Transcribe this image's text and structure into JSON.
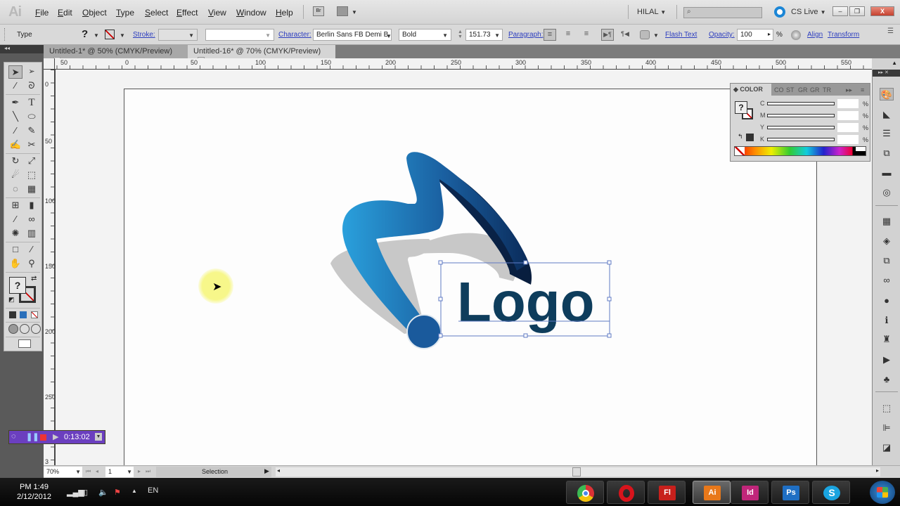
{
  "app": {
    "logo": "Ai",
    "name": "Adobe Illustrator"
  },
  "menu": [
    "File",
    "Edit",
    "Object",
    "Type",
    "Select",
    "Effect",
    "View",
    "Window",
    "Help"
  ],
  "menubar_right": {
    "workspace": "HILAL",
    "search_placeholder": "",
    "cs_live": "CS Live"
  },
  "window_controls": {
    "minimize": "–",
    "restore": "❐",
    "close": "X"
  },
  "control_bar": {
    "tool_name": "Type",
    "fill": "?",
    "stroke_label": "Stroke:",
    "stroke_value": "",
    "style_value": "",
    "character_label": "Character:",
    "font_family": "Berlin Sans FB Demi B",
    "font_style": "Bold",
    "font_size": "151.73",
    "paragraph_label": "Paragraph:",
    "flash_text": "Flash Text",
    "opacity_label": "Opacity:",
    "opacity_value": "100",
    "opacity_unit": "%",
    "align": "Align",
    "transform": "Transform"
  },
  "tabs": [
    {
      "label": "Untitled-1* @ 50% (CMYK/Preview)",
      "active": false
    },
    {
      "label": "Untitled-16* @ 70% (CMYK/Preview)",
      "active": true
    }
  ],
  "tools": [
    "selection",
    "direct-selection",
    "magic-wand",
    "lasso",
    "pen",
    "type",
    "line",
    "ellipse",
    "paintbrush",
    "pencil",
    "blob-brush",
    "scissors",
    "rotate",
    "scale",
    "warp",
    "free-transform",
    "shape-builder",
    "perspective-grid",
    "mesh",
    "gradient",
    "eyedropper",
    "blend",
    "symbol-sprayer",
    "column-graph",
    "artboard",
    "slice",
    "hand",
    "zoom"
  ],
  "ruler": {
    "horizontal": [
      "50",
      "0",
      "50",
      "100",
      "150",
      "200",
      "250",
      "300",
      "350",
      "400",
      "450",
      "500",
      "550"
    ],
    "vertical": [
      "0",
      "50",
      "100",
      "150",
      "200",
      "250",
      "3"
    ]
  },
  "artwork": {
    "logo_text": "Logo",
    "colors": {
      "gradient_light": "#2a9ad8",
      "gradient_dark": "#0b2c5c",
      "text": "#0e3d5c",
      "shadow": "#c8c8c8"
    }
  },
  "color_panel": {
    "title": "COLOR",
    "other_tabs": [
      "CO",
      "ST",
      "GR",
      "GR",
      "TR"
    ],
    "sliders": [
      {
        "label": "C",
        "value": "",
        "unit": "%"
      },
      {
        "label": "M",
        "value": "",
        "unit": "%"
      },
      {
        "label": "Y",
        "value": "",
        "unit": "%"
      },
      {
        "label": "K",
        "value": "",
        "unit": "%"
      }
    ]
  },
  "dock_icons": [
    "color",
    "color-guide",
    "stroke",
    "transparency",
    "gradient",
    "appearance",
    "swatches",
    "layers",
    "artboards",
    "links",
    "graphic-styles",
    "info",
    "actions",
    "brush",
    "symbols",
    "transform",
    "align",
    "pathfinder"
  ],
  "status_bar": {
    "zoom": "70%",
    "page": "1",
    "status": "Selection"
  },
  "recorder": {
    "time": "0:13:02"
  },
  "taskbar": {
    "time": "PM 1:49",
    "date": "2/12/2012",
    "language": "EN",
    "apps": [
      {
        "name": "Chrome",
        "label": "",
        "color": "#3c9a3c"
      },
      {
        "name": "Opera",
        "label": "O",
        "color": "#d8141c"
      },
      {
        "name": "Flash",
        "label": "Fl",
        "color": "#c8201c"
      },
      {
        "name": "Illustrator",
        "label": "Ai",
        "color": "#e8781a",
        "active": true
      },
      {
        "name": "InDesign",
        "label": "Id",
        "color": "#c0267a"
      },
      {
        "name": "Photoshop",
        "label": "Ps",
        "color": "#1f6fc4"
      },
      {
        "name": "Skype",
        "label": "S",
        "color": "#1aa4e0"
      }
    ]
  }
}
